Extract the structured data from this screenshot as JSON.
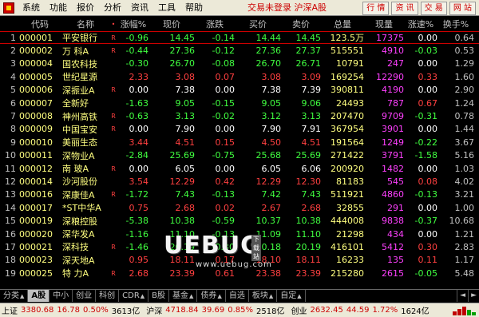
{
  "menubar": {
    "items": [
      "系统",
      "功能",
      "报价",
      "分析",
      "资讯",
      "工具",
      "帮助"
    ],
    "status": "交易未登录  沪深A股",
    "buttons": [
      "行 情",
      "资 讯",
      "交 易",
      "网 站"
    ]
  },
  "table": {
    "headers": {
      "idx": "",
      "code": "代码",
      "name": "名称",
      "mark": "•",
      "chg": "涨幅%",
      "price": "现价",
      "diff": "涨跌",
      "buy": "买价",
      "sell": "卖价",
      "vol": "总量",
      "cur": "现量",
      "spd": "涨速%",
      "turn": "换手%"
    },
    "rows": [
      {
        "idx": "1",
        "code": "000001",
        "name": "平安银行",
        "mark": "R",
        "chg": "-0.96",
        "price": "14.45",
        "diff": "-0.14",
        "buy": "14.44",
        "sell": "14.45",
        "vol": "123.5万",
        "cur": "17375",
        "spd": "0.00",
        "turn": "0.64",
        "dir": "dn",
        "spd_dir": "eq"
      },
      {
        "idx": "2",
        "code": "000002",
        "name": "万 科A",
        "mark": "R",
        "chg": "-0.44",
        "price": "27.36",
        "diff": "-0.12",
        "buy": "27.36",
        "sell": "27.37",
        "vol": "515551",
        "cur": "4910",
        "spd": "-0.03",
        "turn": "0.53",
        "dir": "dn",
        "spd_dir": "dn"
      },
      {
        "idx": "3",
        "code": "000004",
        "name": "国农科技",
        "mark": "",
        "chg": "-0.30",
        "price": "26.70",
        "diff": "-0.08",
        "buy": "26.70",
        "sell": "26.71",
        "vol": "10791",
        "cur": "247",
        "spd": "0.00",
        "turn": "1.29",
        "dir": "dn",
        "spd_dir": "eq"
      },
      {
        "idx": "4",
        "code": "000005",
        "name": "世纪星源",
        "mark": "",
        "chg": "2.33",
        "price": "3.08",
        "diff": "0.07",
        "buy": "3.08",
        "sell": "3.09",
        "vol": "169254",
        "cur": "12290",
        "spd": "0.33",
        "turn": "1.60",
        "dir": "up",
        "spd_dir": "up"
      },
      {
        "idx": "5",
        "code": "000006",
        "name": "深振业A",
        "mark": "R",
        "chg": "0.00",
        "price": "7.38",
        "diff": "0.00",
        "buy": "7.38",
        "sell": "7.39",
        "vol": "390811",
        "cur": "4190",
        "spd": "0.00",
        "turn": "2.90",
        "dir": "eq",
        "spd_dir": "eq"
      },
      {
        "idx": "6",
        "code": "000007",
        "name": "全新好",
        "mark": "",
        "chg": "-1.63",
        "price": "9.05",
        "diff": "-0.15",
        "buy": "9.05",
        "sell": "9.06",
        "vol": "24493",
        "cur": "787",
        "spd": "0.67",
        "turn": "1.24",
        "dir": "dn",
        "spd_dir": "up"
      },
      {
        "idx": "7",
        "code": "000008",
        "name": "神州高铁",
        "mark": "R",
        "chg": "-0.63",
        "price": "3.13",
        "diff": "-0.02",
        "buy": "3.12",
        "sell": "3.13",
        "vol": "207470",
        "cur": "9709",
        "spd": "-0.31",
        "turn": "0.78",
        "dir": "dn",
        "spd_dir": "dn"
      },
      {
        "idx": "8",
        "code": "000009",
        "name": "中国宝安",
        "mark": "R",
        "chg": "0.00",
        "price": "7.90",
        "diff": "0.00",
        "buy": "7.90",
        "sell": "7.91",
        "vol": "367954",
        "cur": "3901",
        "spd": "0.00",
        "turn": "1.44",
        "dir": "eq",
        "spd_dir": "eq"
      },
      {
        "idx": "9",
        "code": "000010",
        "name": "美丽生态",
        "mark": "",
        "chg": "3.44",
        "price": "4.51",
        "diff": "0.15",
        "buy": "4.50",
        "sell": "4.51",
        "vol": "191564",
        "cur": "1249",
        "spd": "-0.22",
        "turn": "3.67",
        "dir": "up",
        "spd_dir": "dn"
      },
      {
        "idx": "10",
        "code": "000011",
        "name": "深物业A",
        "mark": "",
        "chg": "-2.84",
        "price": "25.69",
        "diff": "-0.75",
        "buy": "25.68",
        "sell": "25.69",
        "vol": "271422",
        "cur": "3791",
        "spd": "-1.58",
        "turn": "5.16",
        "dir": "dn",
        "spd_dir": "dn"
      },
      {
        "idx": "11",
        "code": "000012",
        "name": "南 玻A",
        "mark": "R",
        "chg": "0.00",
        "price": "6.05",
        "diff": "0.00",
        "buy": "6.05",
        "sell": "6.06",
        "vol": "200920",
        "cur": "1482",
        "spd": "0.00",
        "turn": "1.03",
        "dir": "eq",
        "spd_dir": "eq"
      },
      {
        "idx": "12",
        "code": "000014",
        "name": "沙河股份",
        "mark": "",
        "chg": "3.54",
        "price": "12.29",
        "diff": "0.42",
        "buy": "12.29",
        "sell": "12.30",
        "vol": "81183",
        "cur": "545",
        "spd": "0.08",
        "turn": "4.02",
        "dir": "up",
        "spd_dir": "up"
      },
      {
        "idx": "13",
        "code": "000016",
        "name": "深康佳A",
        "mark": "R",
        "chg": "-1.72",
        "price": "7.43",
        "diff": "-0.13",
        "buy": "7.42",
        "sell": "7.43",
        "vol": "511921",
        "cur": "4860",
        "spd": "-0.13",
        "turn": "3.21",
        "dir": "dn",
        "spd_dir": "dn"
      },
      {
        "idx": "14",
        "code": "000017",
        "name": "*ST中华A",
        "mark": "",
        "chg": "0.75",
        "price": "2.68",
        "diff": "0.02",
        "buy": "2.67",
        "sell": "2.68",
        "vol": "32855",
        "cur": "291",
        "spd": "0.00",
        "turn": "1.00",
        "dir": "up",
        "spd_dir": "eq"
      },
      {
        "idx": "15",
        "code": "000019",
        "name": "深粮控股",
        "mark": "",
        "chg": "-5.38",
        "price": "10.38",
        "diff": "-0.59",
        "buy": "10.37",
        "sell": "10.38",
        "vol": "444008",
        "cur": "9838",
        "spd": "-0.37",
        "turn": "10.68",
        "dir": "dn",
        "spd_dir": "dn"
      },
      {
        "idx": "16",
        "code": "000020",
        "name": "深华发A",
        "mark": "",
        "chg": "-1.16",
        "price": "11.10",
        "diff": "-0.13",
        "buy": "11.09",
        "sell": "11.10",
        "vol": "21298",
        "cur": "434",
        "spd": "0.00",
        "turn": "1.21",
        "dir": "dn",
        "spd_dir": "eq"
      },
      {
        "idx": "17",
        "code": "000021",
        "name": "深科技",
        "mark": "R",
        "chg": "-1.46",
        "price": "20.19",
        "diff": "-0.30",
        "buy": "20.18",
        "sell": "20.19",
        "vol": "416101",
        "cur": "5412",
        "spd": "0.30",
        "turn": "2.83",
        "dir": "dn",
        "spd_dir": "up"
      },
      {
        "idx": "18",
        "code": "000023",
        "name": "深天地A",
        "mark": "",
        "chg": "0.95",
        "price": "18.11",
        "diff": "0.17",
        "buy": "18.10",
        "sell": "18.11",
        "vol": "16233",
        "cur": "135",
        "spd": "0.11",
        "turn": "1.17",
        "dir": "up",
        "spd_dir": "up"
      },
      {
        "idx": "19",
        "code": "000025",
        "name": "特 力A",
        "mark": "R",
        "chg": "2.68",
        "price": "23.39",
        "diff": "0.61",
        "buy": "23.38",
        "sell": "23.39",
        "vol": "215280",
        "cur": "2615",
        "spd": "-0.05",
        "turn": "5.48",
        "dir": "up",
        "spd_dir": "dn"
      }
    ]
  },
  "watermark": {
    "text": "UEBUG",
    "badge": "下载站",
    "url": "www.uebug.com"
  },
  "tabs": {
    "items": [
      {
        "label": "分类",
        "arrow": "▲",
        "active": false
      },
      {
        "label": "A股",
        "arrow": "",
        "active": true
      },
      {
        "label": "中小",
        "arrow": "",
        "active": false
      },
      {
        "label": "创业",
        "arrow": "",
        "active": false
      },
      {
        "label": "科创",
        "arrow": "",
        "active": false
      },
      {
        "label": "CDR",
        "arrow": "▲",
        "active": false
      },
      {
        "label": "B股",
        "arrow": "",
        "active": false
      },
      {
        "label": "基金",
        "arrow": "▲",
        "active": false
      },
      {
        "label": "债券",
        "arrow": "▲",
        "active": false
      },
      {
        "label": "自选",
        "arrow": "",
        "active": false
      },
      {
        "label": "板块",
        "arrow": "▲",
        "active": false
      },
      {
        "label": "自定",
        "arrow": "▲",
        "active": false
      }
    ],
    "nav": [
      "◄",
      "►"
    ]
  },
  "statusbar": {
    "sh_label": "上证",
    "sh_index": "3380.68",
    "sh_chg": "16.78",
    "sh_pct": "0.50%",
    "sh_amt": "3613亿",
    "sz_label": "沪深",
    "sz_index": "4718.84",
    "sz_chg": "39.69",
    "sz_pct": "0.85%",
    "sz_amt": "2518亿",
    "cy_label": "创业",
    "cy_index": "2632.45",
    "cy_chg": "44.59",
    "cy_pct": "1.72%",
    "cy_amt": "1624亿",
    "colors": {
      "up": "#c00000",
      "down": "#00a000"
    }
  }
}
